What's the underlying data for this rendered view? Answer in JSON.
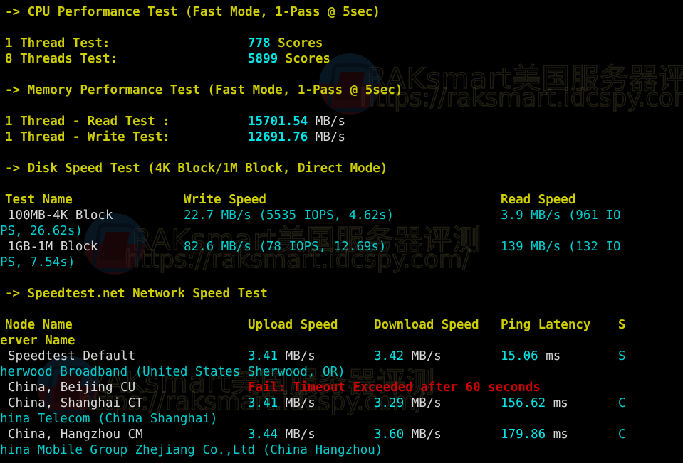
{
  "terminal": {
    "background": "#000000",
    "colors": {
      "heading": "#cdcd00",
      "value": "#00cdcd",
      "label_white": "#d8d8d8",
      "error": "#cd0000"
    }
  },
  "watermark": {
    "brand_cn": "RAKsmart美国服务器评测",
    "url": "https://raksmart.idcspy.com/",
    "logo_name": "raksmart-logo"
  },
  "cpu_section": {
    "heading": "-> CPU Performance Test (Fast Mode, 1-Pass @ 5sec)",
    "rows": [
      {
        "label": "1 Thread Test:",
        "value": "778",
        "unit": "Scores"
      },
      {
        "label": "8 Threads Test:",
        "value": "5899",
        "unit": "Scores"
      }
    ]
  },
  "memory_section": {
    "heading": "-> Memory Performance Test (Fast Mode, 1-Pass @ 5sec)",
    "rows": [
      {
        "label": "1 Thread - Read Test :",
        "value": "15701.54",
        "unit": "MB/s"
      },
      {
        "label": "1 Thread - Write Test:",
        "value": "12691.76",
        "unit": "MB/s"
      }
    ]
  },
  "disk_section": {
    "heading": "-> Disk Speed Test (4K Block/1M Block, Direct Mode)",
    "headers": {
      "test_name": "Test Name",
      "write_speed": "Write Speed",
      "read_speed": "Read Speed"
    },
    "rows": [
      {
        "name": "100MB-4K Block",
        "write": "22.7 MB/s (5535 IOPS, 4.62s)",
        "read_part1": "3.9 MB/s (961 IO",
        "read_part2": "PS, 26.62s)"
      },
      {
        "name": "1GB-1M Block",
        "write": "82.6 MB/s (78 IOPS, 12.69s)",
        "read_part1": "139 MB/s (132 IO",
        "read_part2": "PS, 7.54s)"
      }
    ]
  },
  "speedtest_section": {
    "heading": "-> Speedtest.net Network Speed Test",
    "headers": {
      "node_name": "Node Name",
      "upload_speed": "Upload Speed",
      "download_speed": "Download Speed",
      "ping_latency": "Ping Latency",
      "server_name_part1": "S",
      "server_name_part2": "erver Name"
    },
    "rows": [
      {
        "node": "Speedtest Default",
        "upload_value": "3.41",
        "upload_unit": "MB/s",
        "download_value": "3.42",
        "download_unit": "MB/s",
        "ping_value": "15.06",
        "ping_unit": "ms",
        "server_head": "S",
        "server_rest": "herwood Broadband (United States Sherwood, OR)",
        "failed": false
      },
      {
        "node": "China, Beijing CU",
        "error": "Fail: Timeout Exceeded after 60 seconds",
        "failed": true
      },
      {
        "node": "China, Shanghai CT",
        "upload_value": "3.41",
        "upload_unit": "MB/s",
        "download_value": "3.29",
        "download_unit": "MB/s",
        "ping_value": "156.62",
        "ping_unit": "ms",
        "server_head": "C",
        "server_rest": "hina Telecom (China Shanghai)",
        "failed": false
      },
      {
        "node": "China, Hangzhou CM",
        "upload_value": "3.44",
        "upload_unit": "MB/s",
        "download_value": "3.60",
        "download_unit": "MB/s",
        "ping_value": "179.86",
        "ping_unit": "ms",
        "server_head": "C",
        "server_rest": "hina Mobile Group Zhejiang Co.,Ltd (China Hangzhou)",
        "failed": false
      }
    ]
  }
}
